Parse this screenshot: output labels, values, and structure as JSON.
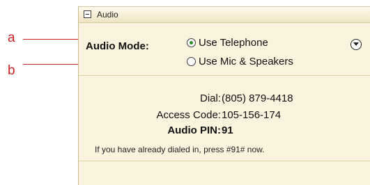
{
  "callouts": {
    "a": "a",
    "b": "b"
  },
  "panel": {
    "title": "Audio",
    "collapse_icon": "minus-box-icon",
    "mode_label": "Audio Mode:",
    "options": [
      {
        "label": "Use Telephone",
        "selected": true
      },
      {
        "label": "Use Mic & Speakers",
        "selected": false
      }
    ],
    "menu_icon": "chevron-down-circle-icon",
    "dial_label": "Dial:",
    "dial_value": "(805) 879-4418",
    "access_label": "Access Code:",
    "access_value": "105-156-174",
    "pin_label": "Audio PIN:",
    "pin_value": "91",
    "note": "If you have already dialed in, press #91# now."
  },
  "colors": {
    "panel_bg": "#faf3dd",
    "callout": "#cc1f1f",
    "radio_selected": "#2f8a2f"
  }
}
